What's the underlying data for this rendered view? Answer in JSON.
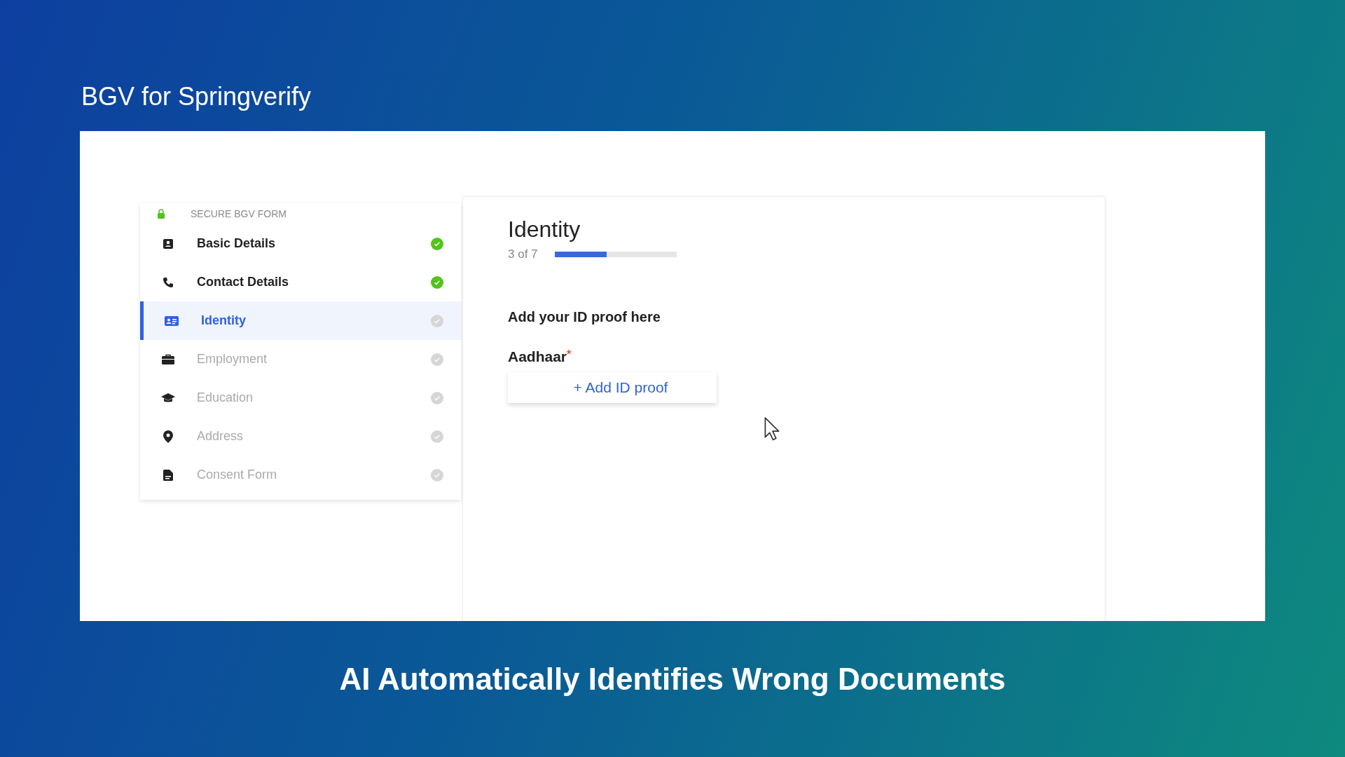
{
  "heading": "BGV for Springverify",
  "sidebar": {
    "header": "SECURE BGV FORM",
    "items": [
      {
        "label": "Basic Details",
        "completed": true,
        "selected": false
      },
      {
        "label": "Contact Details",
        "completed": true,
        "selected": false
      },
      {
        "label": "Identity",
        "completed": false,
        "selected": true
      },
      {
        "label": "Employment",
        "completed": false,
        "selected": false
      },
      {
        "label": "Education",
        "completed": false,
        "selected": false
      },
      {
        "label": "Address",
        "completed": false,
        "selected": false
      },
      {
        "label": "Consent Form",
        "completed": false,
        "selected": false
      }
    ]
  },
  "main": {
    "title": "Identity",
    "step": "3 of 7",
    "progress": {
      "level": 0.43
    },
    "section_title": "Add your ID proof here",
    "field_label": "Aadhaar",
    "required_mark": "*",
    "button": "+ Add ID proof"
  },
  "caption": "AI Automatically Identifies Wrong Documents"
}
